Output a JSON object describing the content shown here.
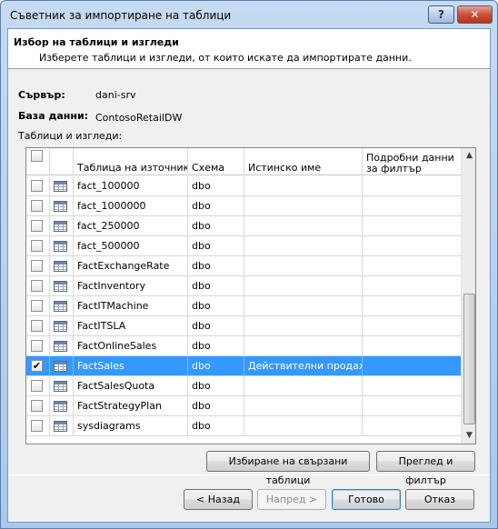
{
  "window": {
    "title": "Съветник за импортиране на таблици",
    "help_label": "?",
    "close_label": "✕"
  },
  "header": {
    "title": "Избор на таблици и изгледи",
    "subtitle": "Изберете таблици и изгледи, от които искате да импортирате данни."
  },
  "server": {
    "label": "Сървър:",
    "value": "dani-srv"
  },
  "database": {
    "label": "База данни:",
    "value": "ContosoRetailDW"
  },
  "tables_label": "Таблици и изгледи:",
  "grid": {
    "columns": [
      "Таблица на източник",
      "Схема",
      "Истинско име",
      "Подробни данни за филтър"
    ],
    "rows": [
      {
        "name": "fact_100000",
        "schema": "dbo",
        "friendly": "",
        "filter": "",
        "checked": false,
        "selected": false
      },
      {
        "name": "fact_1000000",
        "schema": "dbo",
        "friendly": "",
        "filter": "",
        "checked": false,
        "selected": false
      },
      {
        "name": "fact_250000",
        "schema": "dbo",
        "friendly": "",
        "filter": "",
        "checked": false,
        "selected": false
      },
      {
        "name": "fact_500000",
        "schema": "dbo",
        "friendly": "",
        "filter": "",
        "checked": false,
        "selected": false
      },
      {
        "name": "FactExchangeRate",
        "schema": "dbo",
        "friendly": "",
        "filter": "",
        "checked": false,
        "selected": false
      },
      {
        "name": "FactInventory",
        "schema": "dbo",
        "friendly": "",
        "filter": "",
        "checked": false,
        "selected": false
      },
      {
        "name": "FactITMachine",
        "schema": "dbo",
        "friendly": "",
        "filter": "",
        "checked": false,
        "selected": false
      },
      {
        "name": "FactITSLA",
        "schema": "dbo",
        "friendly": "",
        "filter": "",
        "checked": false,
        "selected": false
      },
      {
        "name": "FactOnlineSales",
        "schema": "dbo",
        "friendly": "",
        "filter": "",
        "checked": false,
        "selected": false
      },
      {
        "name": "FactSales",
        "schema": "dbo",
        "friendly": "Действителни продажби",
        "filter": "",
        "checked": true,
        "selected": true
      },
      {
        "name": "FactSalesQuota",
        "schema": "dbo",
        "friendly": "",
        "filter": "",
        "checked": false,
        "selected": false
      },
      {
        "name": "FactStrategyPlan",
        "schema": "dbo",
        "friendly": "",
        "filter": "",
        "checked": false,
        "selected": false
      },
      {
        "name": "sysdiagrams",
        "schema": "dbo",
        "friendly": "",
        "filter": "",
        "checked": false,
        "selected": false
      }
    ]
  },
  "buttons": {
    "select_related": "Избиране на свързани таблици",
    "preview_filter": "Преглед и филтър",
    "back": "< Назад",
    "next": "Напред >",
    "finish": "Готово",
    "cancel": "Отказ"
  }
}
